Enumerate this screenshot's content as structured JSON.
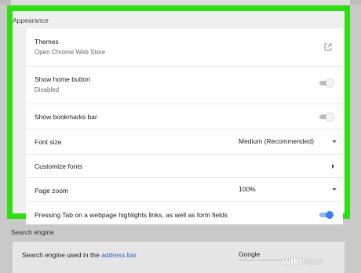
{
  "appearance": {
    "title": "Appearance",
    "themes": {
      "label": "Themes",
      "subtitle": "Open Chrome Web Store",
      "icon": "open-in-new-icon"
    },
    "home_button": {
      "label": "Show home button",
      "subtitle": "Disabled",
      "enabled": false
    },
    "bookmarks_bar": {
      "label": "Show bookmarks bar",
      "enabled": false
    },
    "font_size": {
      "label": "Font size",
      "value": "Medium (Recommended)"
    },
    "customize_fonts": {
      "label": "Customize fonts",
      "icon": "chevron-right-icon"
    },
    "page_zoom": {
      "label": "Page zoom",
      "value": "100%"
    },
    "tab_highlight": {
      "label": "Pressing Tab on a webpage highlights links, as well as form fields",
      "enabled": true
    }
  },
  "search_engine": {
    "title": "Search engine",
    "row_label_prefix": "Search engine used in the ",
    "row_label_link": "address bar",
    "value": "Google"
  },
  "watermark": {
    "part1": "wiki",
    "part2": "How"
  },
  "colors": {
    "highlight_frame": "#2de010",
    "toggle_on": "#3f7ee9",
    "link": "#3565b8"
  }
}
